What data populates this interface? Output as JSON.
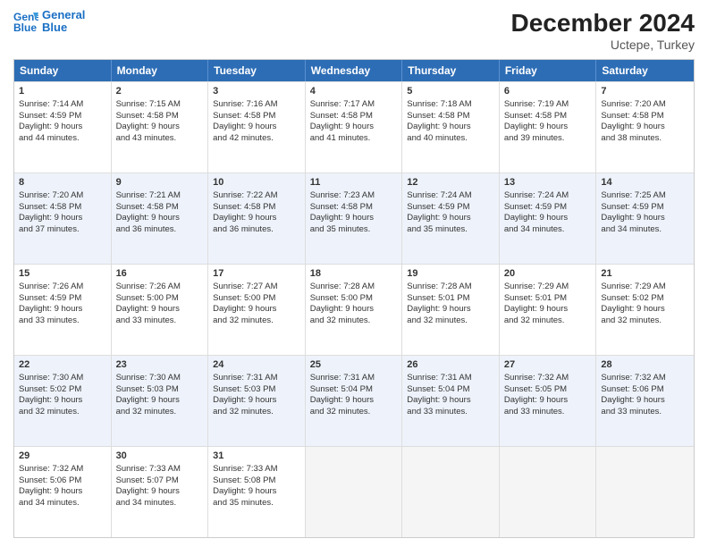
{
  "logo": {
    "line1": "General",
    "line2": "Blue"
  },
  "title": "December 2024",
  "subtitle": "Uctepe, Turkey",
  "headers": [
    "Sunday",
    "Monday",
    "Tuesday",
    "Wednesday",
    "Thursday",
    "Friday",
    "Saturday"
  ],
  "weeks": [
    {
      "alt": false,
      "days": [
        {
          "num": "1",
          "lines": [
            "Sunrise: 7:14 AM",
            "Sunset: 4:59 PM",
            "Daylight: 9 hours",
            "and 44 minutes."
          ]
        },
        {
          "num": "2",
          "lines": [
            "Sunrise: 7:15 AM",
            "Sunset: 4:58 PM",
            "Daylight: 9 hours",
            "and 43 minutes."
          ]
        },
        {
          "num": "3",
          "lines": [
            "Sunrise: 7:16 AM",
            "Sunset: 4:58 PM",
            "Daylight: 9 hours",
            "and 42 minutes."
          ]
        },
        {
          "num": "4",
          "lines": [
            "Sunrise: 7:17 AM",
            "Sunset: 4:58 PM",
            "Daylight: 9 hours",
            "and 41 minutes."
          ]
        },
        {
          "num": "5",
          "lines": [
            "Sunrise: 7:18 AM",
            "Sunset: 4:58 PM",
            "Daylight: 9 hours",
            "and 40 minutes."
          ]
        },
        {
          "num": "6",
          "lines": [
            "Sunrise: 7:19 AM",
            "Sunset: 4:58 PM",
            "Daylight: 9 hours",
            "and 39 minutes."
          ]
        },
        {
          "num": "7",
          "lines": [
            "Sunrise: 7:20 AM",
            "Sunset: 4:58 PM",
            "Daylight: 9 hours",
            "and 38 minutes."
          ]
        }
      ]
    },
    {
      "alt": true,
      "days": [
        {
          "num": "8",
          "lines": [
            "Sunrise: 7:20 AM",
            "Sunset: 4:58 PM",
            "Daylight: 9 hours",
            "and 37 minutes."
          ]
        },
        {
          "num": "9",
          "lines": [
            "Sunrise: 7:21 AM",
            "Sunset: 4:58 PM",
            "Daylight: 9 hours",
            "and 36 minutes."
          ]
        },
        {
          "num": "10",
          "lines": [
            "Sunrise: 7:22 AM",
            "Sunset: 4:58 PM",
            "Daylight: 9 hours",
            "and 36 minutes."
          ]
        },
        {
          "num": "11",
          "lines": [
            "Sunrise: 7:23 AM",
            "Sunset: 4:58 PM",
            "Daylight: 9 hours",
            "and 35 minutes."
          ]
        },
        {
          "num": "12",
          "lines": [
            "Sunrise: 7:24 AM",
            "Sunset: 4:59 PM",
            "Daylight: 9 hours",
            "and 35 minutes."
          ]
        },
        {
          "num": "13",
          "lines": [
            "Sunrise: 7:24 AM",
            "Sunset: 4:59 PM",
            "Daylight: 9 hours",
            "and 34 minutes."
          ]
        },
        {
          "num": "14",
          "lines": [
            "Sunrise: 7:25 AM",
            "Sunset: 4:59 PM",
            "Daylight: 9 hours",
            "and 34 minutes."
          ]
        }
      ]
    },
    {
      "alt": false,
      "days": [
        {
          "num": "15",
          "lines": [
            "Sunrise: 7:26 AM",
            "Sunset: 4:59 PM",
            "Daylight: 9 hours",
            "and 33 minutes."
          ]
        },
        {
          "num": "16",
          "lines": [
            "Sunrise: 7:26 AM",
            "Sunset: 5:00 PM",
            "Daylight: 9 hours",
            "and 33 minutes."
          ]
        },
        {
          "num": "17",
          "lines": [
            "Sunrise: 7:27 AM",
            "Sunset: 5:00 PM",
            "Daylight: 9 hours",
            "and 32 minutes."
          ]
        },
        {
          "num": "18",
          "lines": [
            "Sunrise: 7:28 AM",
            "Sunset: 5:00 PM",
            "Daylight: 9 hours",
            "and 32 minutes."
          ]
        },
        {
          "num": "19",
          "lines": [
            "Sunrise: 7:28 AM",
            "Sunset: 5:01 PM",
            "Daylight: 9 hours",
            "and 32 minutes."
          ]
        },
        {
          "num": "20",
          "lines": [
            "Sunrise: 7:29 AM",
            "Sunset: 5:01 PM",
            "Daylight: 9 hours",
            "and 32 minutes."
          ]
        },
        {
          "num": "21",
          "lines": [
            "Sunrise: 7:29 AM",
            "Sunset: 5:02 PM",
            "Daylight: 9 hours",
            "and 32 minutes."
          ]
        }
      ]
    },
    {
      "alt": true,
      "days": [
        {
          "num": "22",
          "lines": [
            "Sunrise: 7:30 AM",
            "Sunset: 5:02 PM",
            "Daylight: 9 hours",
            "and 32 minutes."
          ]
        },
        {
          "num": "23",
          "lines": [
            "Sunrise: 7:30 AM",
            "Sunset: 5:03 PM",
            "Daylight: 9 hours",
            "and 32 minutes."
          ]
        },
        {
          "num": "24",
          "lines": [
            "Sunrise: 7:31 AM",
            "Sunset: 5:03 PM",
            "Daylight: 9 hours",
            "and 32 minutes."
          ]
        },
        {
          "num": "25",
          "lines": [
            "Sunrise: 7:31 AM",
            "Sunset: 5:04 PM",
            "Daylight: 9 hours",
            "and 32 minutes."
          ]
        },
        {
          "num": "26",
          "lines": [
            "Sunrise: 7:31 AM",
            "Sunset: 5:04 PM",
            "Daylight: 9 hours",
            "and 33 minutes."
          ]
        },
        {
          "num": "27",
          "lines": [
            "Sunrise: 7:32 AM",
            "Sunset: 5:05 PM",
            "Daylight: 9 hours",
            "and 33 minutes."
          ]
        },
        {
          "num": "28",
          "lines": [
            "Sunrise: 7:32 AM",
            "Sunset: 5:06 PM",
            "Daylight: 9 hours",
            "and 33 minutes."
          ]
        }
      ]
    },
    {
      "alt": false,
      "days": [
        {
          "num": "29",
          "lines": [
            "Sunrise: 7:32 AM",
            "Sunset: 5:06 PM",
            "Daylight: 9 hours",
            "and 34 minutes."
          ]
        },
        {
          "num": "30",
          "lines": [
            "Sunrise: 7:33 AM",
            "Sunset: 5:07 PM",
            "Daylight: 9 hours",
            "and 34 minutes."
          ]
        },
        {
          "num": "31",
          "lines": [
            "Sunrise: 7:33 AM",
            "Sunset: 5:08 PM",
            "Daylight: 9 hours",
            "and 35 minutes."
          ]
        },
        null,
        null,
        null,
        null
      ]
    }
  ]
}
